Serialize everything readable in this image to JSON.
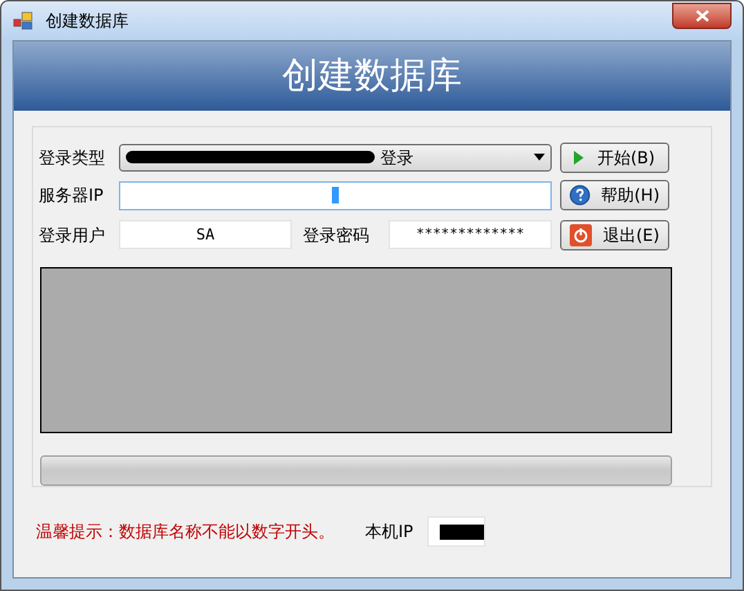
{
  "window": {
    "title": "创建数据库"
  },
  "banner": {
    "title": "创建数据库"
  },
  "form": {
    "login_type": {
      "label": "登录类型",
      "value": "登录"
    },
    "server_ip": {
      "label": "服务器IP",
      "focused": true
    },
    "user": {
      "label": "登录用户",
      "value": "SA"
    },
    "password": {
      "label": "登录密码",
      "value": "*************"
    }
  },
  "buttons": [
    {
      "kind": "start",
      "label": "开始(B)"
    },
    {
      "kind": "help",
      "label": "帮助(H)"
    },
    {
      "kind": "exit",
      "label": "退出(E)"
    }
  ],
  "progress": {
    "level": 0
  },
  "footer": {
    "tip": "温馨提示：数据库名称不能以数字开头。",
    "ip_label": "本机IP"
  }
}
